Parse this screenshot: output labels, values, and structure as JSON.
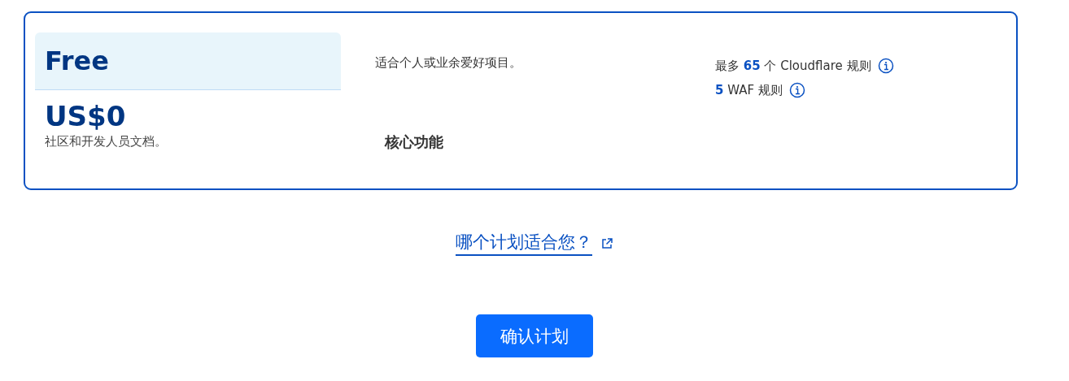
{
  "plan": {
    "name": "Free",
    "price": "US$0",
    "support": "社区和开发人员文档。",
    "description": "适合个人或业余爱好项目。",
    "features_heading": "核心功能",
    "limits": [
      {
        "text": "最多 **65** 个 Cloudflare 规则",
        "info": true
      },
      {
        "text": "**5** WAF 规则",
        "info": true
      }
    ]
  },
  "help_link": "哪个计划适合您？",
  "confirm_button": "确认计划"
}
